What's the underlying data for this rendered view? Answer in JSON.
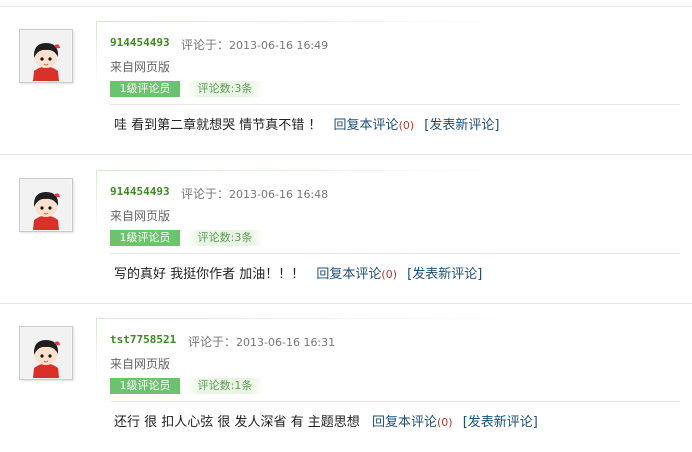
{
  "comments": [
    {
      "user": "914454493",
      "label": "评论于：",
      "time": "2013-06-16 16:49",
      "source": "来自网页版",
      "level": "1级评论员",
      "count": "评论数:3条",
      "text": "哇 看到第二章就想哭 情节真不错 ！",
      "reply_label": "回复本评论",
      "reply_count": "(0)",
      "new_comment_label": "[发表新评论]"
    },
    {
      "user": "914454493",
      "label": "评论于：",
      "time": "2013-06-16 16:48",
      "source": "来自网页版",
      "level": "1级评论员",
      "count": "评论数:3条",
      "text": "写的真好 我挺你作者 加油！！！",
      "reply_label": "回复本评论",
      "reply_count": "(0)",
      "new_comment_label": "[发表新评论]"
    },
    {
      "user": "tst7758521",
      "label": "评论于：",
      "time": "2013-06-16 16:31",
      "source": "来自网页版",
      "level": "1级评论员",
      "count": "评论数:1条",
      "text": "还行 很 扣人心弦 很 发人深省 有 主题思想",
      "reply_label": "回复本评论",
      "reply_count": "(0)",
      "new_comment_label": "[发表新评论]"
    }
  ],
  "icons": {
    "avatar": "cartoon-avatar-icon"
  },
  "colors": {
    "username": "#3c8a22",
    "level_badge": "#6bc46d",
    "link": "#1d4f76",
    "count": "#c0392b"
  }
}
